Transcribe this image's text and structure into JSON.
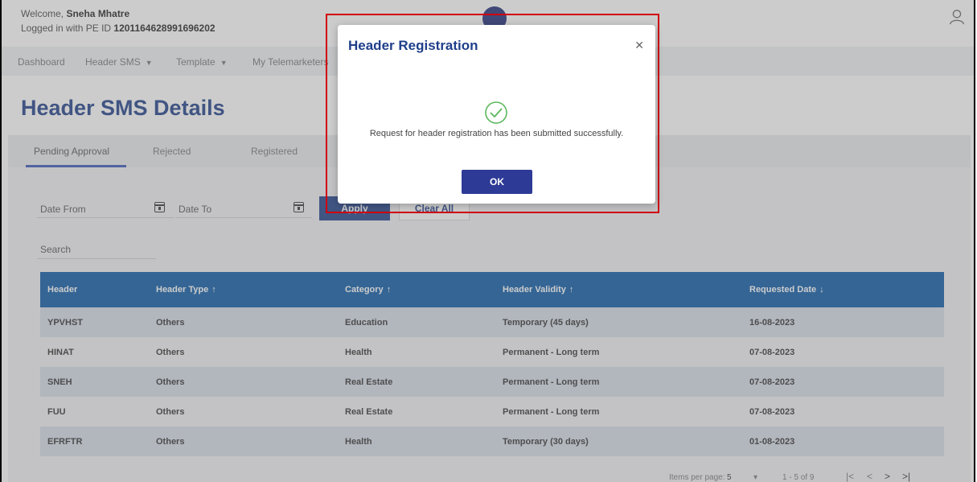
{
  "header": {
    "welcome_prefix": "Welcome, ",
    "user_name": "Sneha Mhatre",
    "pe_prefix": "Logged in with PE ID ",
    "pe_id": "1201164628991696202"
  },
  "nav": {
    "items": [
      "Dashboard",
      "Header SMS",
      "Template",
      "My Telemarketers"
    ]
  },
  "page": {
    "title": "Header SMS Details"
  },
  "tabs": [
    "Pending Approval",
    "Rejected",
    "Registered"
  ],
  "filters": {
    "date_from": "Date From",
    "date_to": "Date To",
    "apply": "Apply",
    "clear_all": "Clear All",
    "search": "Search"
  },
  "table": {
    "columns": [
      "Header",
      "Header Type",
      "Category",
      "Header Validity",
      "Requested Date"
    ],
    "rows": [
      [
        "YPVHST",
        "Others",
        "Education",
        "Temporary (45 days)",
        "16-08-2023"
      ],
      [
        "HINAT",
        "Others",
        "Health",
        "Permanent - Long term",
        "07-08-2023"
      ],
      [
        "SNEH",
        "Others",
        "Real Estate",
        "Permanent - Long term",
        "07-08-2023"
      ],
      [
        "FUU",
        "Others",
        "Real Estate",
        "Permanent - Long term",
        "07-08-2023"
      ],
      [
        "EFRFTR",
        "Others",
        "Health",
        "Temporary (30 days)",
        "01-08-2023"
      ]
    ]
  },
  "pager": {
    "items_per_page_label": "Items per page:",
    "items_per_page": "5",
    "range": "1 - 5 of 9"
  },
  "modal": {
    "title": "Header Registration",
    "message": "Request for header registration has been submitted successfully.",
    "ok": "OK"
  },
  "colors": {
    "primary": "#1f3f8a",
    "table_header": "#0b5aa6",
    "success": "#5cb85c",
    "highlight": "#d0000f"
  }
}
